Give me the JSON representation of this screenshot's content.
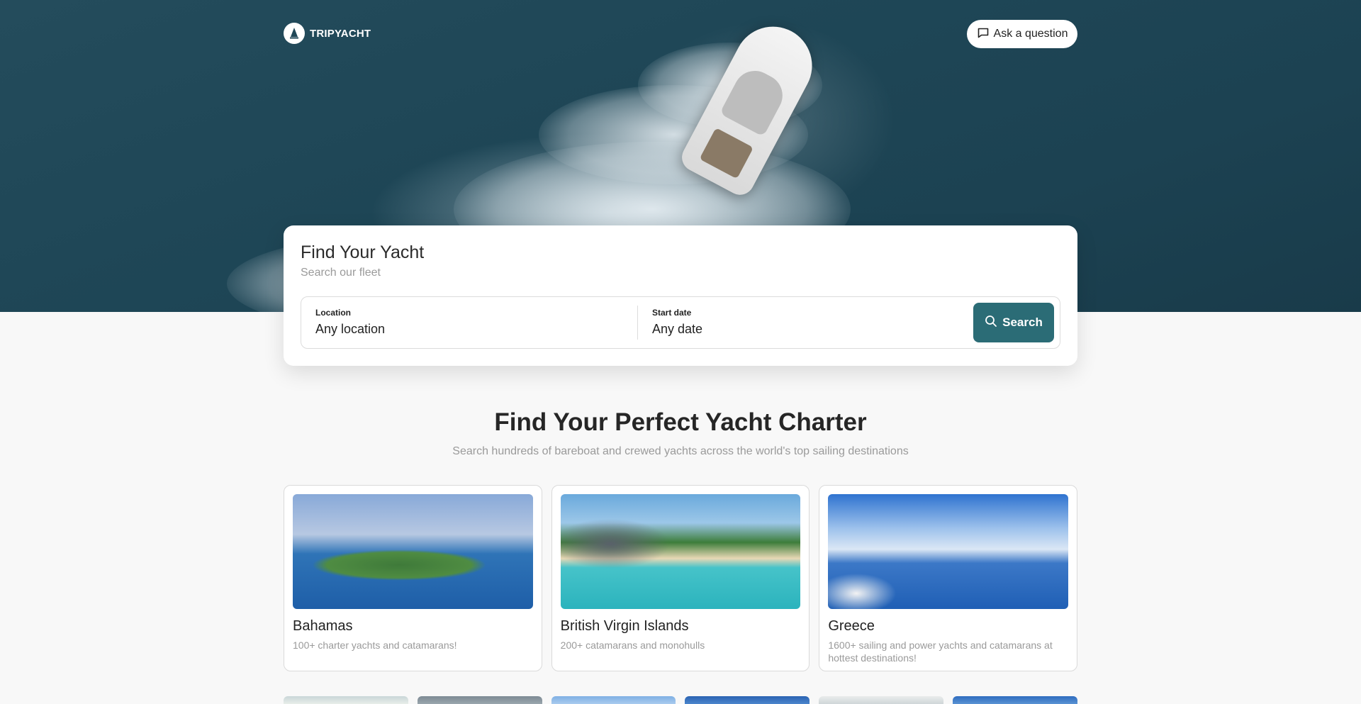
{
  "brand": {
    "name": "TRIPYACHT"
  },
  "header": {
    "ask_label": "Ask a question"
  },
  "search_card": {
    "title": "Find Your Yacht",
    "subtitle": "Search our fleet",
    "location": {
      "label": "Location",
      "value": "Any location"
    },
    "start_date": {
      "label": "Start date",
      "value": "Any date"
    },
    "search_label": "Search"
  },
  "section": {
    "title": "Find Your Perfect Yacht Charter",
    "subtitle": "Search hundreds of bareboat and crewed yachts across the world's top sailing destinations"
  },
  "destinations": [
    {
      "name": "Bahamas",
      "desc": "100+ charter yachts and catamarans!"
    },
    {
      "name": "British Virgin Islands",
      "desc": "200+ catamarans and monohulls"
    },
    {
      "name": "Greece",
      "desc": "1600+ sailing and power yachts and catamarans at hottest destinations!"
    }
  ],
  "colors": {
    "accent": "#2b6c76",
    "hero_water": "#1f4757"
  }
}
